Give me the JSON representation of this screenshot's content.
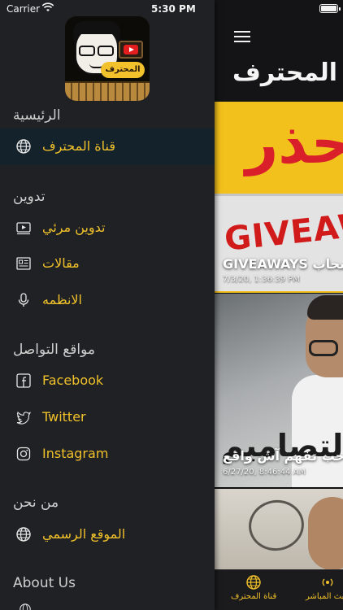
{
  "status_bar": {
    "carrier": "Carrier",
    "time": "5:30 PM"
  },
  "header": {
    "title": "المحترف"
  },
  "drawer": {
    "avatar_badge": "المحترف",
    "sections": [
      {
        "title": "الرئيسية",
        "items": [
          {
            "label": "قناة المحترف",
            "icon": "globe-icon",
            "active": true
          }
        ]
      },
      {
        "title": "تدوين",
        "items": [
          {
            "label": "تدوين مرئي",
            "icon": "video-icon"
          },
          {
            "label": "مقالات",
            "icon": "newspaper-icon"
          },
          {
            "label": "الانظمه",
            "icon": "microphone-icon"
          }
        ]
      },
      {
        "title": "مواقع التواصل",
        "items": [
          {
            "label": "Facebook",
            "icon": "facebook-icon"
          },
          {
            "label": "Twitter",
            "icon": "twitter-icon"
          },
          {
            "label": "Instagram",
            "icon": "instagram-icon"
          }
        ]
      },
      {
        "title": "من نحن",
        "items": [
          {
            "label": "الموقع الرسمي",
            "icon": "globe-icon"
          }
        ]
      },
      {
        "title": "About Us",
        "items": []
      }
    ]
  },
  "feed": {
    "items": [
      {
        "thumb_text_top": "حذر",
        "thumb_text_band": "GIVEAWAYS",
        "caption": "GIVEAWAYS سحاب",
        "date": "7/3/20, 1:36:39 PM"
      },
      {
        "thumb_text": "التصاميم",
        "caption": "أحب تفهم آش واقع",
        "date": "6/27/20, 8:46:44 AM"
      },
      {
        "thumb_text": ""
      }
    ]
  },
  "tabbar": {
    "tabs": [
      {
        "label": "قناة المحترف",
        "icon": "globe-icon",
        "active": true
      },
      {
        "label": "البث المباشر",
        "icon": "broadcast-icon",
        "active": false
      }
    ]
  },
  "colors": {
    "accent": "#f0c12a",
    "drawer_bg": "#202124",
    "active_row": "#14222c",
    "background": "#141416"
  }
}
